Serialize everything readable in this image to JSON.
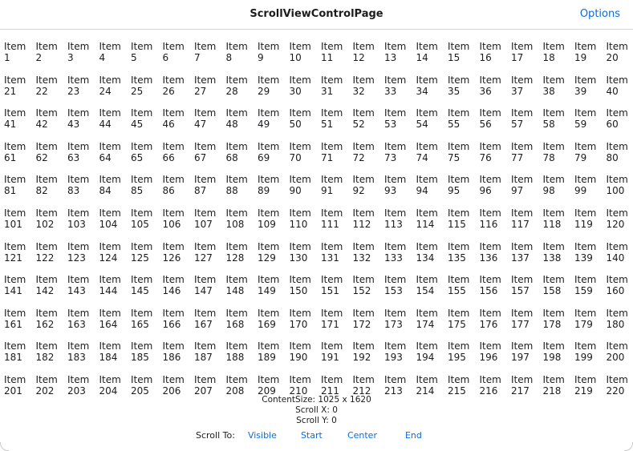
{
  "nav": {
    "title": "ScrollViewControlPage",
    "options_label": "Options"
  },
  "grid": {
    "item_prefix": "Item",
    "first_item": 1,
    "last_item": 220
  },
  "info": {
    "content_size": "ContentSize: 1025 x 1620",
    "scroll_x": "Scroll X: 0",
    "scroll_y": "Scroll Y: 0"
  },
  "scroll_to": {
    "label": "Scroll To:",
    "buttons": [
      "Visible",
      "Start",
      "Center",
      "End"
    ]
  },
  "colors": {
    "accent": "#0a6ce0",
    "text": "#1c1c1e",
    "divider": "#d4d4d8"
  }
}
